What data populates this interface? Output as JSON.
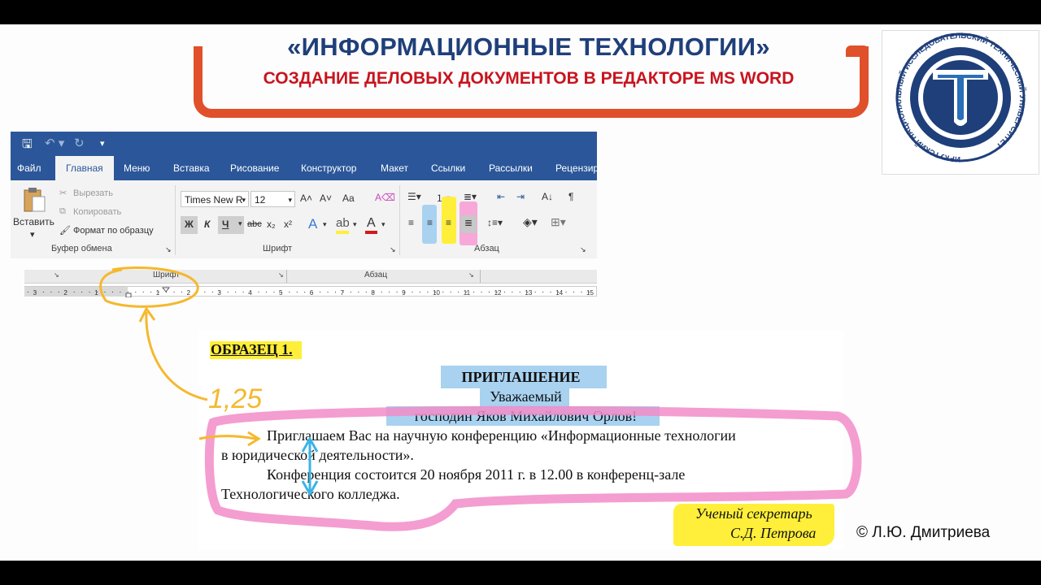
{
  "header": {
    "title": "«ИНФОРМАЦИОННЫЕ ТЕХНОЛОГИИ»",
    "subtitle": "СОЗДАНИЕ ДЕЛОВЫХ ДОКУМЕНТОВ В РЕДАКТОРЕ MS WORD",
    "accent_color": "#e0502a",
    "title_color": "#1f3f7a",
    "subtitle_color": "#c8141e"
  },
  "logo": {
    "text": "ИРКУТСКИЙ НАЦИОНАЛЬНЫЙ ИССЛЕДОВАТЕЛЬСКИЙ ТЕХНИЧЕСКИЙ УНИВЕРСИТЕТ",
    "color": "#1f3f7a"
  },
  "ribbon": {
    "tabs": [
      "Файл",
      "Главная",
      "Меню",
      "Вставка",
      "Рисование",
      "Конструктор",
      "Макет",
      "Ссылки",
      "Рассылки",
      "Рецензир"
    ],
    "clipboard": {
      "paste": "Вставить",
      "cut": "Вырезать",
      "copy": "Копировать",
      "format_painter": "Формат по образцу",
      "group": "Буфер обмена"
    },
    "font": {
      "name": "Times New R",
      "size": "12",
      "bold": "Ж",
      "italic": "К",
      "underline": "Ч",
      "strike": "abc",
      "subscript": "x₂",
      "superscript": "x²",
      "grow": "A˄",
      "shrink": "A˅",
      "case": "Aa",
      "group": "Шрифт"
    },
    "paragraph": {
      "group": "Абзац"
    }
  },
  "ruler_labels": {
    "font": "Шрифт",
    "paragraph": "Абзац",
    "ticks": [
      "3",
      "2",
      "1",
      "1",
      "2",
      "3",
      "4",
      "5",
      "6",
      "7",
      "8",
      "9",
      "10",
      "11",
      "12",
      "13",
      "14",
      "15"
    ]
  },
  "annotation": {
    "indent_value": "1,25"
  },
  "document": {
    "sample_label": "ОБРАЗЕЦ 1.",
    "heading": "ПРИГЛАШЕНИЕ",
    "greeting_line1": "Уважаемый",
    "greeting_line2": "господин Яков Михайлович Орлов!",
    "para1_line1": "Приглашаем Вас на научную конференцию «Информационные технологии",
    "para1_line2": "в юридической деятельности».",
    "para2_line1": "Конференция состоится 20 ноября 2011 г. в 12.00 в конференц-зале",
    "para2_line2": "Технологического колледжа.",
    "signature_line1": "Ученый секретарь",
    "signature_line2": "С.Д. Петрова"
  },
  "copyright": "© Л.Ю. Дмитриева"
}
